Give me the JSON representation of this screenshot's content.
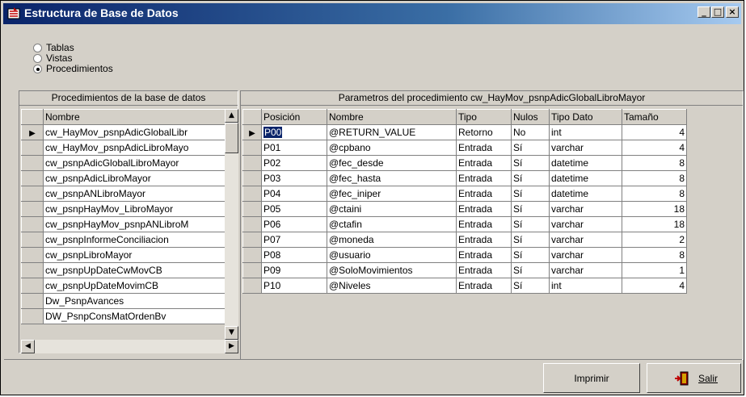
{
  "window": {
    "title": "Estructura de Base de Datos",
    "minimize": "_",
    "maximize": "□",
    "close": "×"
  },
  "radios": [
    {
      "label": "Tablas",
      "selected": false
    },
    {
      "label": "Vistas",
      "selected": false
    },
    {
      "label": "Procedimientos",
      "selected": true
    }
  ],
  "left_panel": {
    "title": "Procedimientos de la base de datos",
    "column": "Nombre",
    "items": [
      "cw_HayMov_psnpAdicGlobalLibr",
      "cw_HayMov_psnpAdicLibroMayo",
      "cw_psnpAdicGlobalLibroMayor",
      "cw_psnpAdicLibroMayor",
      "cw_psnpANLibroMayor",
      "cw_psnpHayMov_LibroMayor",
      "cw_psnpHayMov_psnpANLibroM",
      "cw_psnpInformeConciliacion",
      "cw_psnpLibroMayor",
      "cw_psnpUpDateCwMovCB",
      "cw_psnpUpDateMovimCB",
      "Dw_PsnpAvances",
      "DW_PsnpConsMatOrdenBv"
    ]
  },
  "right_panel": {
    "title": "Parametros del procedimiento cw_HayMov_psnpAdicGlobalLibroMayor",
    "columns": [
      "Posición",
      "Nombre",
      "Tipo",
      "Nulos",
      "Tipo Dato",
      "Tamaño"
    ],
    "rows": [
      [
        "P00",
        "@RETURN_VALUE",
        "Retorno",
        "No",
        "int",
        "4"
      ],
      [
        "P01",
        "@cpbano",
        "Entrada",
        "Sí",
        "varchar",
        "4"
      ],
      [
        "P02",
        "@fec_desde",
        "Entrada",
        "Sí",
        "datetime",
        "8"
      ],
      [
        "P03",
        "@fec_hasta",
        "Entrada",
        "Sí",
        "datetime",
        "8"
      ],
      [
        "P04",
        "@fec_iniper",
        "Entrada",
        "Sí",
        "datetime",
        "8"
      ],
      [
        "P05",
        "@ctaini",
        "Entrada",
        "Sí",
        "varchar",
        "18"
      ],
      [
        "P06",
        "@ctafin",
        "Entrada",
        "Sí",
        "varchar",
        "18"
      ],
      [
        "P07",
        "@moneda",
        "Entrada",
        "Sí",
        "varchar",
        "2"
      ],
      [
        "P08",
        "@usuario",
        "Entrada",
        "Sí",
        "varchar",
        "8"
      ],
      [
        "P09",
        "@SoloMovimientos",
        "Entrada",
        "Sí",
        "varchar",
        "1"
      ],
      [
        "P10",
        "@Niveles",
        "Entrada",
        "Sí",
        "int",
        "4"
      ]
    ]
  },
  "buttons": {
    "print": "Imprimir",
    "exit": "Salir"
  }
}
